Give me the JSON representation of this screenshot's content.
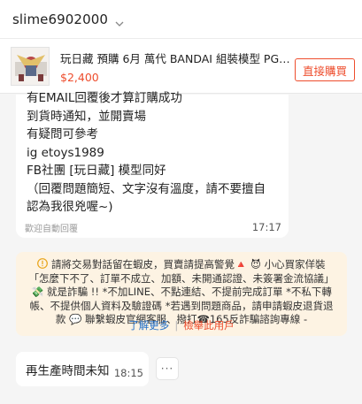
{
  "header": {
    "username": "slime6902000"
  },
  "product": {
    "title": "玩日藏 預購 6月 萬代 BANDAI 組裝模型 PG E...",
    "price": "$2,400",
    "buy_label": "直接購買"
  },
  "messages": [
    {
      "lines": [
        "有EMAIL回覆後才算訂購成功",
        "到貨時通知，並開賣場",
        "有疑問可參考",
        "ig etoys1989",
        "FB社團 [玩日藏] 模型同好",
        "（回覆問題簡短、文字沒有溫度，請不要擅自",
        "認為我很兇喔~)"
      ],
      "footer": "歡迎自動回覆",
      "time": "17:17"
    },
    {
      "text": "再生產時間未知",
      "time": "18:15"
    }
  ],
  "notice": {
    "line1": "請將交易對話留在蝦皮，買賣請提高警覺🔺 😈 小心買家佯裝",
    "line2": "「怎麼下不了、訂單不成立、加額、未開通認證、未簽署金流協議」",
    "line3": "💸 就是詐騙 !! *不加LINE、不點連結、不提前完成訂單 *不私下轉",
    "line4": "帳、不提供個人資料及驗證碼 *若遇到問題商品，請申請蝦皮退貨退",
    "line5": "款 💬 聯繫蝦皮官網客服、撥打☎165反詐騙諮詢專線 -",
    "learn_more": "了解更多",
    "report": "檢舉此用戶"
  },
  "more_label": "···",
  "colors": {
    "accent": "#ee4d2d",
    "link": "#2370c9",
    "notice_bg": "#fdf3e3"
  }
}
